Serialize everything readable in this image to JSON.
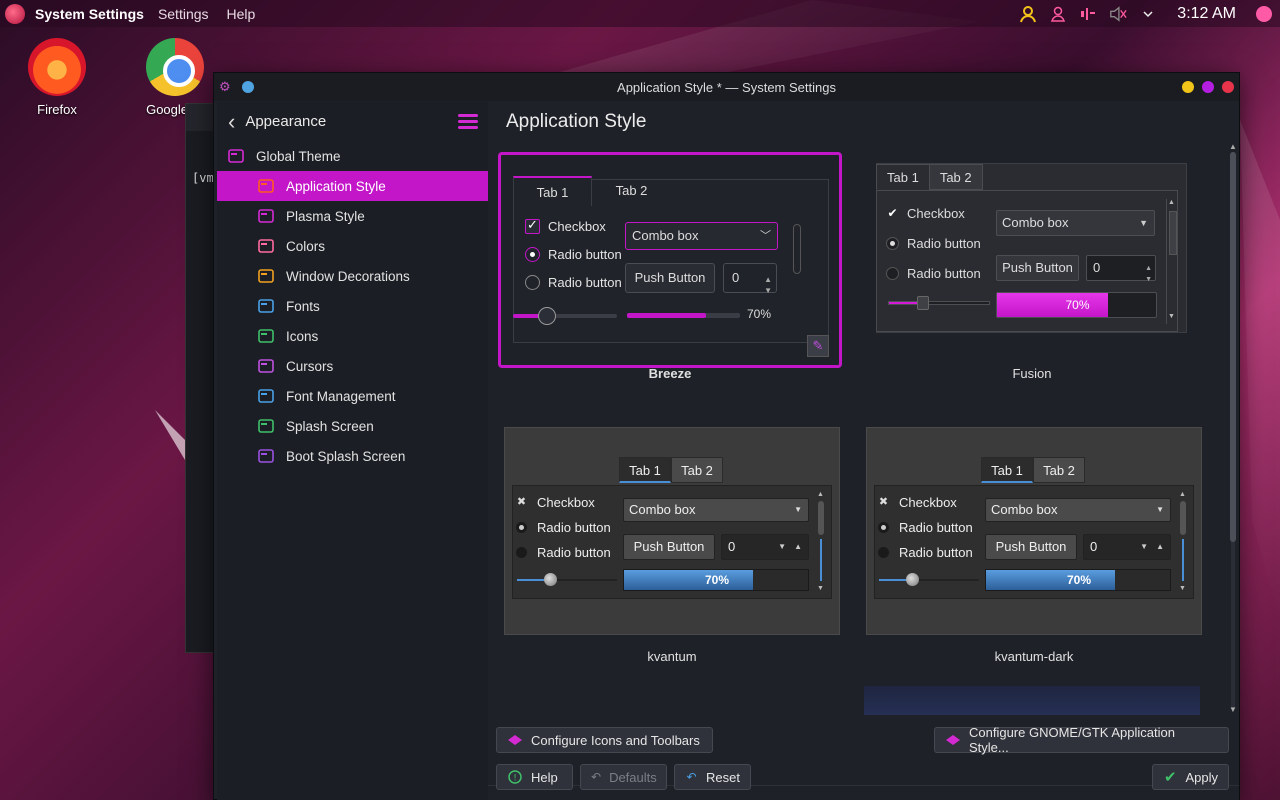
{
  "top_panel": {
    "app_name": "System Settings",
    "menus": [
      "Settings",
      "Help"
    ],
    "clock": "3:12 AM",
    "tray_icons": [
      "user-icon",
      "account-icon",
      "network-icon",
      "volume-muted-icon",
      "chevron-down-icon"
    ]
  },
  "desktop": {
    "icons": [
      {
        "label": "Firefox",
        "icon": "firefox-icon"
      },
      {
        "label": "Google Cl",
        "icon": "chrome-icon"
      }
    ],
    "terminal_text": "[vm"
  },
  "window": {
    "title": "Application Style * — System Settings",
    "controls_colors": {
      "minimize": "#f0c419",
      "maximize": "#b31ee0",
      "close": "#e8344b"
    }
  },
  "sidebar": {
    "header": "Appearance",
    "items": [
      {
        "label": "Global Theme",
        "icon": "global-theme-icon",
        "level": 0
      },
      {
        "label": "Application Style",
        "icon": "application-style-icon",
        "level": 1,
        "active": true
      },
      {
        "label": "Plasma Style",
        "icon": "plasma-style-icon",
        "level": 1
      },
      {
        "label": "Colors",
        "icon": "colors-icon",
        "level": 1
      },
      {
        "label": "Window Decorations",
        "icon": "window-decorations-icon",
        "level": 1
      },
      {
        "label": "Fonts",
        "icon": "fonts-icon",
        "level": 1
      },
      {
        "label": "Icons",
        "icon": "icons-icon",
        "level": 1
      },
      {
        "label": "Cursors",
        "icon": "cursors-icon",
        "level": 1
      },
      {
        "label": "Font Management",
        "icon": "font-management-icon",
        "level": 1
      },
      {
        "label": "Splash Screen",
        "icon": "splash-screen-icon",
        "level": 1
      },
      {
        "label": "Boot Splash Screen",
        "icon": "boot-splash-screen-icon",
        "level": 1
      }
    ]
  },
  "content": {
    "title": "Application Style",
    "preview": {
      "tab1": "Tab 1",
      "tab2": "Tab 2",
      "checkbox": "Checkbox",
      "radio": "Radio button",
      "combo": "Combo box",
      "push": "Push Button",
      "spin": "0",
      "progress": "70%",
      "progress_value": 0.7,
      "slider_value": 0.33
    },
    "styles": [
      {
        "name": "Breeze",
        "selected": true
      },
      {
        "name": "Fusion"
      },
      {
        "name": "kvantum"
      },
      {
        "name": "kvantum-dark"
      }
    ]
  },
  "buttons": {
    "configure_icons": "Configure Icons and Toolbars",
    "configure_gtk": "Configure GNOME/GTK Application Style...",
    "help": "Help",
    "defaults": "Defaults",
    "reset": "Reset",
    "apply": "Apply"
  },
  "colors": {
    "accent": "#c416c9",
    "kvantum_accent": "#4a8fd6"
  }
}
